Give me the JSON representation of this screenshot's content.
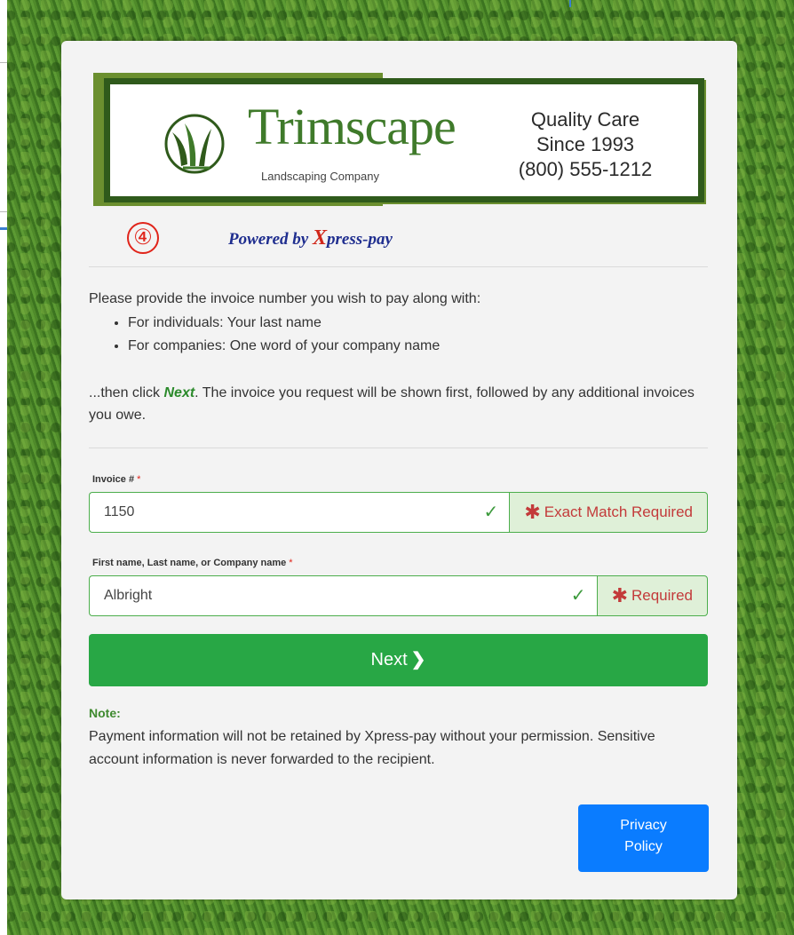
{
  "logo": {
    "brand": "Trimscape",
    "subtitle": "Landscaping Company",
    "tagline_1": "Quality Care",
    "tagline_2": "Since 1993",
    "tagline_3": "(800) 555-1212"
  },
  "step_badge": "④",
  "powered_by": {
    "prefix": "Powered by ",
    "x": "X",
    "suffix": "press-pay"
  },
  "instructions": {
    "intro": "Please provide the invoice number you wish to pay along with:",
    "items": [
      "For individuals: Your last name",
      "For companies: One word of your company name"
    ],
    "then_prefix": "...then click ",
    "then_bold": "Next",
    "then_suffix": ". The invoice you request will be shown first, followed by any additional invoices you owe."
  },
  "form": {
    "invoice_label": "Invoice #",
    "invoice_value": "1150",
    "invoice_hint": "Exact Match Required",
    "name_label": "First name, Last name, or Company name",
    "name_value": "Albright",
    "name_hint": "Required",
    "required_mark": "*",
    "hint_mark": "✱",
    "check": "✓"
  },
  "next_button": {
    "label": "Next",
    "chevron": "❯"
  },
  "note": {
    "title": "Note:",
    "text": "Payment information will not be retained by Xpress-pay without your permission. Sensitive account information is never forwarded to the recipient."
  },
  "privacy_button": {
    "line1": "Privacy",
    "line2": "Policy"
  },
  "colors": {
    "accent_green": "#28a745",
    "brand_green": "#3f7a2a",
    "error_red": "#c33a3a",
    "privacy_blue": "#0a7cff"
  },
  "icons": [
    "grass-logo-icon",
    "check-icon",
    "asterisk-icon",
    "chevron-right-icon"
  ]
}
